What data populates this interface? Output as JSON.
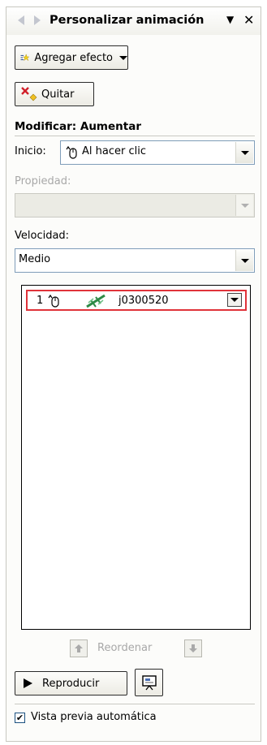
{
  "pane": {
    "title": "Personalizar animación",
    "icons": {
      "back": "back-arrow-icon",
      "forward": "forward-arrow-icon",
      "menu": "dropdown-icon",
      "close": "close-icon"
    }
  },
  "toolbar": {
    "add_effect_label": "Agregar efecto",
    "remove_label": "Quitar"
  },
  "modify": {
    "heading": "Modificar: Aumentar",
    "start_label": "Inicio:",
    "start_value": "Al hacer clic",
    "property_label": "Propiedad:",
    "property_value": "",
    "speed_label": "Velocidad:",
    "speed_value": "Medio"
  },
  "animation_list": {
    "items": [
      {
        "order": "1",
        "trigger": "mouse-click-icon",
        "effect": "grow-effect-icon",
        "name": "j0300520",
        "selected": true
      }
    ]
  },
  "reorder": {
    "label": "Reordenar"
  },
  "playback": {
    "play_label": "Reproducir",
    "slideshow": "slideshow-icon"
  },
  "autopreview": {
    "label": "Vista previa automática",
    "checked": true
  },
  "colors": {
    "selection_border": "#e0333a",
    "disabled_text": "#a8a8a8",
    "pane_bg": "#fcfcfa"
  }
}
